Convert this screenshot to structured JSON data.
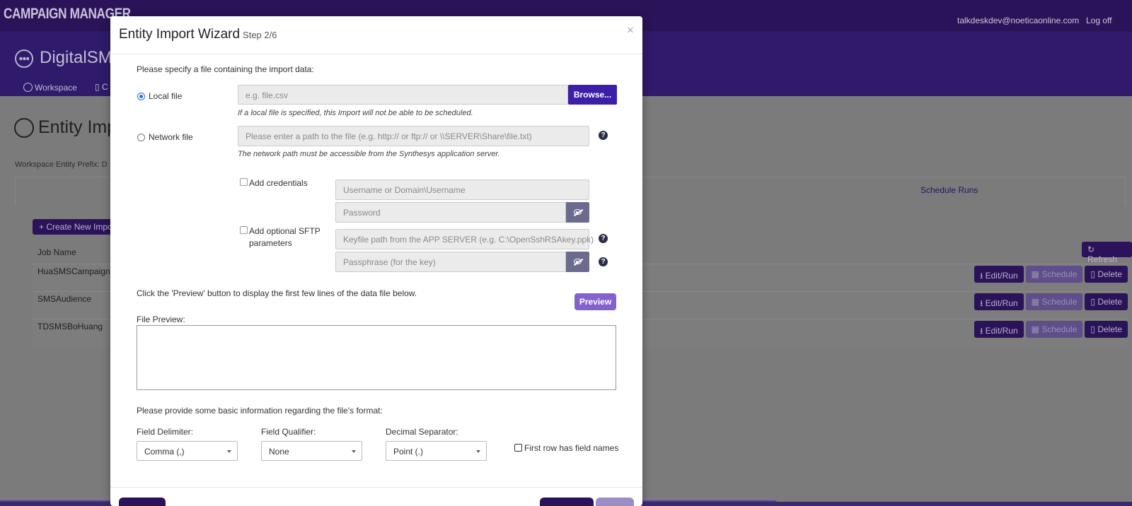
{
  "app": {
    "brand": "CAMPAIGN MANAGER",
    "user_email": "talkdeskdev@noeticaonline.com",
    "logoff_label": "Log off",
    "title": "DigitalSM",
    "nav_workspace": "Workspace",
    "nav_other": "C"
  },
  "page": {
    "title": "Entity Imp",
    "workspace_prefix": "Workspace Entity Prefix: D",
    "schedule_runs_tab": "Schedule Runs",
    "create_button": "+ Create New Impo",
    "refresh_button": "Refresh",
    "job_name_header": "Job Name",
    "jobs": [
      {
        "name": "HuaSMSCampaignE",
        "edit": "Edit/Run",
        "schedule": "Schedule",
        "delete": "Delete"
      },
      {
        "name": "SMSAudience",
        "edit": "Edit/Run",
        "schedule": "Schedule",
        "delete": "Delete"
      },
      {
        "name": "TDSMSBoHuang",
        "edit": "Edit/Run",
        "schedule": "Schedule",
        "delete": "Delete"
      }
    ]
  },
  "modal": {
    "title": "Entity Import Wizard",
    "step": "Step 2/6",
    "close": "×",
    "specify_file": "Please specify a file containing the import data:",
    "local_file_label": "Local file",
    "local_file_placeholder": "e.g. file.csv",
    "browse_label": "Browse...",
    "local_file_hint": "If a local file is specified, this Import will not be able to be scheduled.",
    "network_file_label": "Network file",
    "network_file_placeholder": "Please enter a path to the file (e.g. http:// or ftp:// or \\\\SERVER\\Share\\file.txt)",
    "network_file_hint": "The network path must be accessible from the Synthesys application server.",
    "add_credentials_label": "Add credentials",
    "username_placeholder": "Username or Domain\\Username",
    "password_placeholder": "Password",
    "sftp_label_line1": "Add optional SFTP",
    "sftp_label_line2": "parameters",
    "keyfile_placeholder": "Keyfile path from the APP SERVER (e.g. C:\\OpenSshRSAkey.ppk)",
    "passphrase_placeholder": "Passphrase (for the key)",
    "preview_instruction": "Click the 'Preview' button to display the first few lines of the data file below.",
    "preview_button": "Preview",
    "file_preview_label": "File Preview:",
    "format_instruction": "Please provide some basic information regarding the file's format:",
    "field_delimiter_label": "Field Delimiter:",
    "field_delimiter_value": "Comma (,)",
    "field_qualifier_label": "Field Qualifier:",
    "field_qualifier_value": "None",
    "decimal_separator_label": "Decimal Separator:",
    "decimal_separator_value": "Point (.)",
    "first_row_label": "First row has field names",
    "help_glyph": "?"
  },
  "colors": {
    "brand_dark": "#2a1358",
    "browse_button": "#3d1ea8",
    "preview_button": "#8561d0"
  }
}
